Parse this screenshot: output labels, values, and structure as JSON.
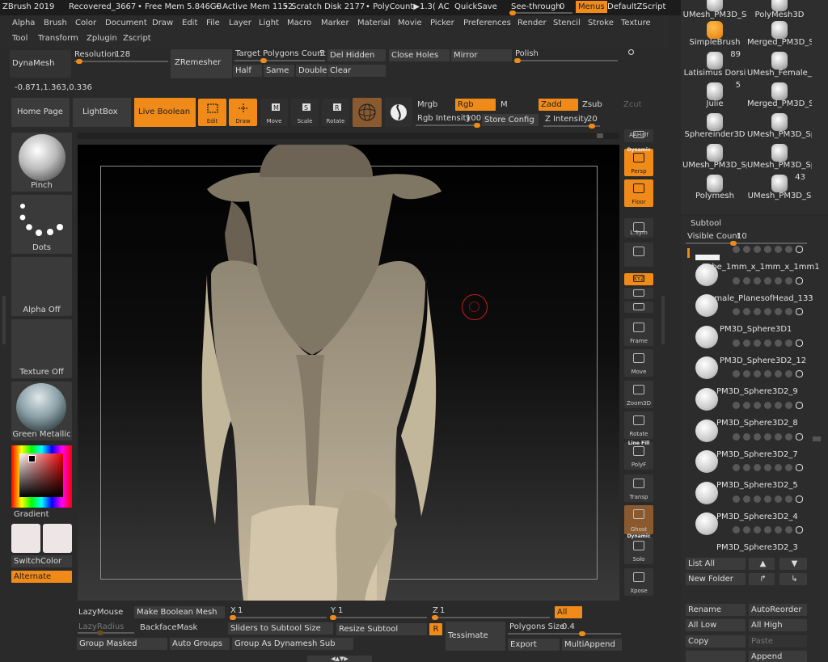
{
  "title_bar": {
    "app": "ZBrush 2019",
    "project": "Recovered_3667",
    "free_mem": "• Free Mem 5.846GB",
    "active_mem": "• Active Mem 1152",
    "scratch": "• Scratch Disk 2177",
    "polycount": "• PolyCount▶1.3( AC",
    "quicksave": "QuickSave",
    "seethrough": "See-through",
    "seethrough_val": "0",
    "menus": "Menus",
    "script": "DefaultZScript"
  },
  "menu_row1": [
    "Alpha",
    "Brush",
    "Color",
    "Document",
    "Draw",
    "Edit",
    "File",
    "Layer",
    "Light",
    "Macro",
    "Marker",
    "Material",
    "Movie",
    "Picker",
    "Preferences",
    "Render",
    "Stencil",
    "Stroke",
    "Texture"
  ],
  "menu_row2": [
    "Tool",
    "Transform",
    "Zplugin",
    "Zscript"
  ],
  "dynamesh": {
    "label": "DynaMesh",
    "resolution": "Resolution",
    "resolution_val": "128",
    "zremesher": "ZRemesher",
    "target": "Target Polygons Count",
    "target_val": "5",
    "half": "Half",
    "same": "Same",
    "double": "Double",
    "del_hidden": "Del Hidden",
    "clear": "Clear",
    "close_holes": "Close Holes",
    "mirror": "Mirror",
    "polish": "Polish"
  },
  "coords": "-0.871,1.363,0.336",
  "shelf": {
    "home": "Home Page",
    "lightbox": "LightBox",
    "live_boolean": "Live Boolean",
    "edit": "Edit",
    "draw": "Draw",
    "move": "Move",
    "scale": "Scale",
    "rotate": "Rotate",
    "mrgb": "Mrgb",
    "rgb": "Rgb",
    "m": "M",
    "zadd": "Zadd",
    "zsub": "Zsub",
    "zcut": "Zcut",
    "rgb_int": "Rgb Intensity",
    "rgb_int_val": "100",
    "store": "Store Config",
    "z_int": "Z Intensity",
    "z_int_val": "20"
  },
  "left": {
    "brush": "Pinch",
    "stroke": "Dots",
    "alpha": "Alpha Off",
    "texture": "Texture Off",
    "material": "Green Metallic",
    "gradient": "Gradient",
    "switch": "SwitchColor",
    "alternate": "Alternate"
  },
  "right_tools": [
    "AAHalf",
    "Persp",
    "Floor",
    "L.Sym",
    "",
    "XYZ",
    "",
    "",
    "Frame",
    "Move",
    "Zoom3D",
    "Rotate",
    "PolyF",
    "Transp",
    "Ghost",
    "Solo",
    "Xpose"
  ],
  "right_tool_captions": {
    "dynamic": "Dynamic",
    "linefill": "Line Fill",
    "dynamic2": "Dynamic"
  },
  "lightbox_tools": [
    {
      "name": "UMesh_PM3D_S",
      "num": ""
    },
    {
      "name": "PolyMesh3D",
      "num": ""
    },
    {
      "name": "SimpleBrush",
      "num": ""
    },
    {
      "name": "Merged_PM3D_S",
      "num": ""
    },
    {
      "name": "Latisimus Dorsi",
      "num": "89"
    },
    {
      "name": "UMesh_Female_l",
      "num": ""
    },
    {
      "name": "Julie",
      "num": "5"
    },
    {
      "name": "Merged_PM3D_S",
      "num": ""
    },
    {
      "name": "Sphereinder3D",
      "num": ""
    },
    {
      "name": "UMesh_PM3D_Sp",
      "num": ""
    },
    {
      "name": "UMesh_PM3D_Sp",
      "num": ""
    },
    {
      "name": "UMesh_PM3D_Sp",
      "num": ""
    },
    {
      "name": "Polymesh",
      "num": ""
    },
    {
      "name": "UMesh_PM3D_S",
      "num": "43"
    }
  ],
  "subtool": {
    "title": "Subtool",
    "visible": "Visible Count",
    "visible_val": "10",
    "items": [
      "Cube_1mm_x_1mm_x_1mm1",
      "Female_PlanesofHead_133",
      "PM3D_Sphere3D1",
      "PM3D_Sphere3D2_12",
      "PM3D_Sphere3D2_9",
      "PM3D_Sphere3D2_8",
      "PM3D_Sphere3D2_7",
      "PM3D_Sphere3D2_5",
      "PM3D_Sphere3D2_4",
      "PM3D_Sphere3D2_3"
    ],
    "list_all": "List All",
    "new_folder": "New Folder",
    "rename": "Rename",
    "autoreorder": "AutoReorder",
    "all_low": "All Low",
    "all_high": "All High",
    "copy": "Copy",
    "paste": "Paste",
    "append": "Append"
  },
  "bottom": {
    "lazymouse": "LazyMouse",
    "lazyradius": "LazyRadius",
    "make_bool": "Make Boolean Mesh",
    "backface": "BackfaceMask",
    "group_masked": "Group Masked",
    "auto_groups": "Auto Groups",
    "group_dyna": "Group As Dynamesh Sub",
    "x": "X",
    "x_val": "1",
    "y": "Y",
    "y_val": "1",
    "z": "Z",
    "z_val": "1",
    "all": "All",
    "sliders": "Sliders to Subtool Size",
    "resize": "Resize Subtool",
    "r": "R",
    "tessimate": "Tessimate",
    "poly_size": "Polygons Size",
    "poly_size_val": "0.4",
    "export": "Export",
    "multiappend": "MultiAppend"
  },
  "colors": {
    "accent": "#f08b1a",
    "panel": "#2a2a2a",
    "button": "#3b3b3b"
  }
}
